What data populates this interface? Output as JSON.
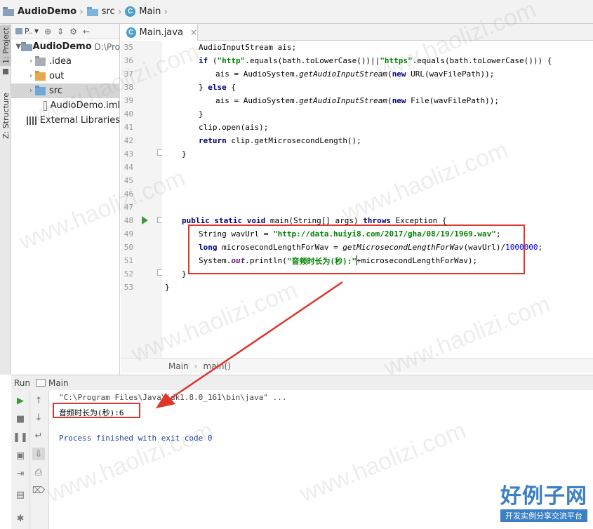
{
  "breadcrumb": {
    "project": "AudioDemo",
    "folder": "src",
    "file": "Main"
  },
  "left_strip": {
    "project_tab": "1: Project",
    "structure_tab": "Z: Structure"
  },
  "project_panel": {
    "view_label": "P..",
    "root": {
      "name": "AudioDemo",
      "path": "D:\\Pro"
    },
    "items": [
      {
        "name": ".idea",
        "type": "folder-gray"
      },
      {
        "name": "out",
        "type": "folder-orange"
      },
      {
        "name": "src",
        "type": "folder-blue",
        "selected": true
      },
      {
        "name": "AudioDemo.iml",
        "type": "file"
      }
    ],
    "external": "External Libraries"
  },
  "editor": {
    "tab": "Main.java",
    "lines": [
      {
        "n": "35"
      },
      {
        "n": "36"
      },
      {
        "n": "37"
      },
      {
        "n": "38"
      },
      {
        "n": "39"
      },
      {
        "n": "40"
      },
      {
        "n": "41"
      },
      {
        "n": "42"
      },
      {
        "n": "43"
      },
      {
        "n": "44"
      },
      {
        "n": "45"
      },
      {
        "n": "46"
      },
      {
        "n": "47"
      },
      {
        "n": "48"
      },
      {
        "n": "49"
      },
      {
        "n": "50"
      },
      {
        "n": "51"
      },
      {
        "n": "52"
      },
      {
        "n": "53"
      }
    ],
    "breadcrumb": {
      "class": "Main",
      "method": "main()"
    }
  },
  "run": {
    "label": "Run",
    "config": "Main",
    "console": {
      "command": "\"C:\\Program Files\\Java\\jdk1.8.0_161\\bin\\java\" ...",
      "output": "音频时长为(秒):6",
      "finished": "Process finished with exit code 0"
    }
  },
  "watermark": "www.haolizi.com",
  "brand": {
    "name": "好例子网",
    "tagline": "开发实例分享交流平台"
  }
}
